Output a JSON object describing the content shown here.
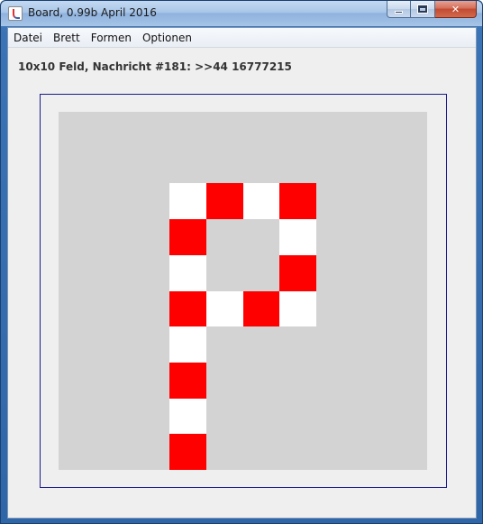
{
  "window": {
    "title": "Board, 0.99b April 2016"
  },
  "menu": {
    "items": [
      {
        "label": "Datei",
        "name": "menu-datei"
      },
      {
        "label": "Brett",
        "name": "menu-brett"
      },
      {
        "label": "Formen",
        "name": "menu-formen"
      },
      {
        "label": "Optionen",
        "name": "menu-optionen"
      }
    ]
  },
  "status": {
    "text": "10x10 Feld, Nachricht #181: >>44 16777215"
  },
  "board": {
    "rows": 10,
    "cols": 10,
    "empty_color": "#d3d3d3",
    "colors": {
      "R": "#ff0000",
      "W": "#ffffff"
    },
    "grid": [
      "..........",
      "..........",
      "...WRWR...",
      "...R..W...",
      "...W..R...",
      "...RWRW...",
      "...W......",
      "...R......",
      "...W......",
      "...R......"
    ]
  }
}
